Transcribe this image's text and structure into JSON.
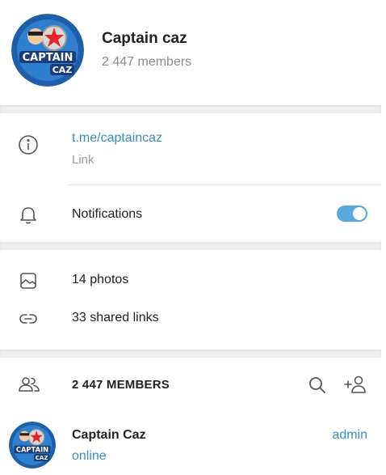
{
  "header": {
    "title": "Captain caz",
    "subtitle": "2 447 members",
    "avatar": {
      "logo_top": "CAPTAIN",
      "logo_bottom": "CAZ"
    }
  },
  "info": {
    "link": "t.me/captaincaz",
    "link_label": "Link",
    "notifications_label": "Notifications",
    "notifications_enabled": true
  },
  "media": {
    "photos": "14 photos",
    "links": "33 shared links"
  },
  "members": {
    "title": "2 447 MEMBERS",
    "list": [
      {
        "name": "Captain Caz",
        "status": "online",
        "role": "admin",
        "avatar": {
          "logo_top": "CAPTAIN",
          "logo_bottom": "CAZ"
        }
      }
    ]
  },
  "colors": {
    "accent": "#3a8cc4",
    "toggle": "#5ca8dd",
    "muted": "#8c8c8c",
    "avatar_bg": "#2b6cb3"
  },
  "icons": {
    "info": "info-icon",
    "notifications": "bell-icon",
    "photos": "photo-icon",
    "links": "link-icon",
    "members": "users-icon",
    "search": "search-icon",
    "add_member": "add-user-icon"
  }
}
